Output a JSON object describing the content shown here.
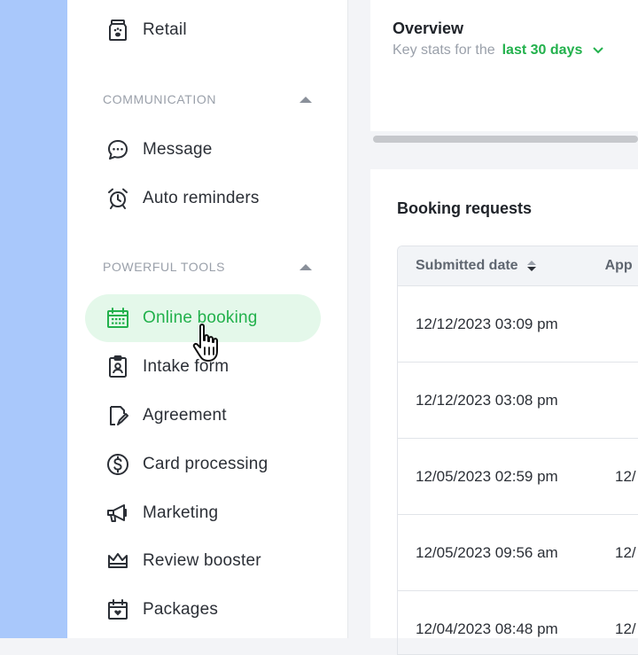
{
  "sidebar": {
    "items": [
      {
        "label": "Retail",
        "icon": "retail-bag-paw-icon"
      },
      {
        "label": "Message",
        "icon": "chat-bubble-icon"
      },
      {
        "label": "Auto reminders",
        "icon": "alarm-clock-icon"
      },
      {
        "label": "Online booking",
        "icon": "calendar-icon",
        "active": true
      },
      {
        "label": "Intake form",
        "icon": "clipboard-person-icon"
      },
      {
        "label": "Agreement",
        "icon": "document-sign-icon"
      },
      {
        "label": "Card processing",
        "icon": "dollar-circle-icon"
      },
      {
        "label": "Marketing",
        "icon": "megaphone-icon"
      },
      {
        "label": "Review booster",
        "icon": "crown-icon"
      },
      {
        "label": "Packages",
        "icon": "package-calendar-icon"
      }
    ],
    "sections": {
      "communication": "COMMUNICATION",
      "powerful_tools": "POWERFUL TOOLS"
    }
  },
  "overview": {
    "title": "Overview",
    "subtitle_prefix": "Key stats for the",
    "range_label": "last 30 days"
  },
  "booking": {
    "title": "Booking requests",
    "columns": [
      "Submitted date",
      "App"
    ],
    "rows": [
      {
        "date": "12/12/2023 03:09 pm",
        "col2": ""
      },
      {
        "date": "12/12/2023 03:08 pm",
        "col2": ""
      },
      {
        "date": "12/05/2023 02:59 pm",
        "col2": "12/"
      },
      {
        "date": "12/05/2023 09:56 am",
        "col2": "12/"
      },
      {
        "date": "12/04/2023 08:48 pm",
        "col2": "12/"
      }
    ]
  },
  "colors": {
    "accent_green": "#22b14c",
    "active_bg": "#e4f8ea",
    "left_strip": "#a9c8fb"
  }
}
